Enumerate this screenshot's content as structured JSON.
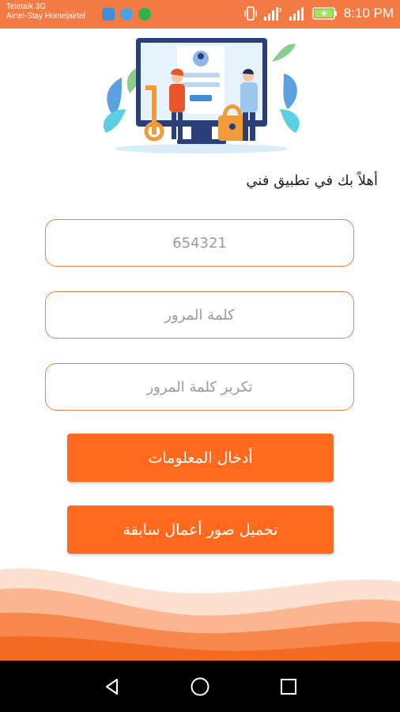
{
  "status_bar": {
    "carrier_line1": "Teletalk 3G",
    "carrier_line2": "Airtel-Stay Home|airtel",
    "time": "8:10 PM",
    "icons": [
      "sim-app-icon",
      "message-icon",
      "do-not-disturb-icon",
      "vibrate-icon",
      "signal-icon",
      "signal-icon",
      "battery-charging-icon"
    ],
    "color": "#f47b43"
  },
  "welcome_text": "أهلاً بك في تطبيق فني",
  "form": {
    "phone": {
      "value": "",
      "placeholder": "654321"
    },
    "password": {
      "value": "",
      "placeholder": "كلمة المرور"
    },
    "confirm_password": {
      "value": "",
      "placeholder": "تكرير كلمة المرور"
    }
  },
  "buttons": {
    "submit_label": "أدخال المعلومات",
    "upload_label": "تحميل صور أعمال سابقة"
  },
  "nav_bar": {
    "icons": [
      "back-icon",
      "home-icon",
      "recents-icon"
    ]
  },
  "colors": {
    "accent": "#f47b43",
    "button": "#ff6a1f",
    "nav_background": "#000000"
  }
}
